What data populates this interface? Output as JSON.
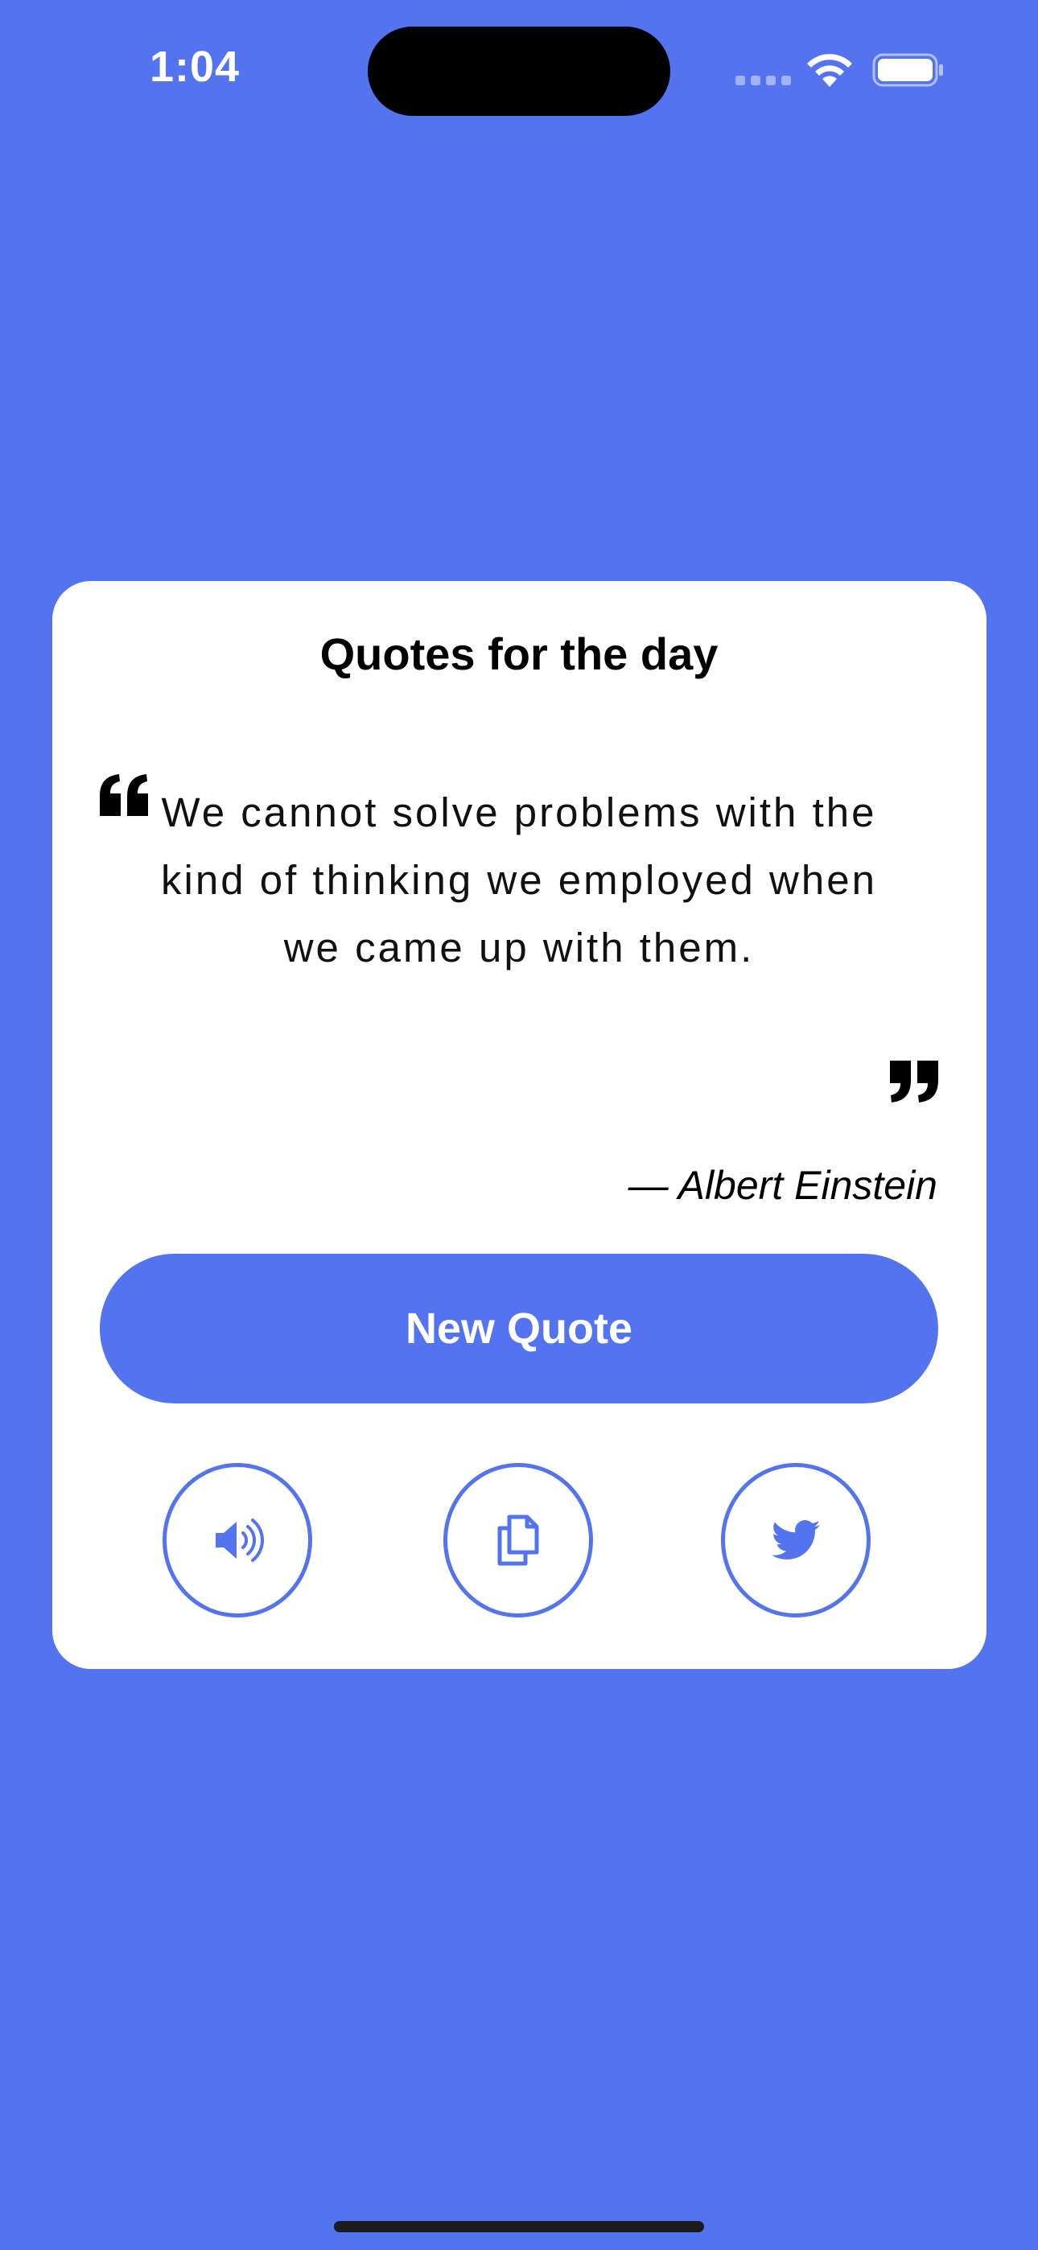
{
  "status_bar": {
    "time": "1:04"
  },
  "card": {
    "title": "Quotes for the day",
    "quote": "We cannot solve problems with the kind of thinking we employed when we came up with them.",
    "author": "— Albert Einstein"
  },
  "actions": {
    "new_quote_label": "New Quote",
    "buttons": [
      {
        "icon": "speaker-icon",
        "action": "speak"
      },
      {
        "icon": "copy-icon",
        "action": "copy"
      },
      {
        "icon": "twitter-icon",
        "action": "tweet"
      }
    ]
  },
  "colors": {
    "background": "#5473ef",
    "card": "#ffffff",
    "accent": "#5473ef"
  }
}
